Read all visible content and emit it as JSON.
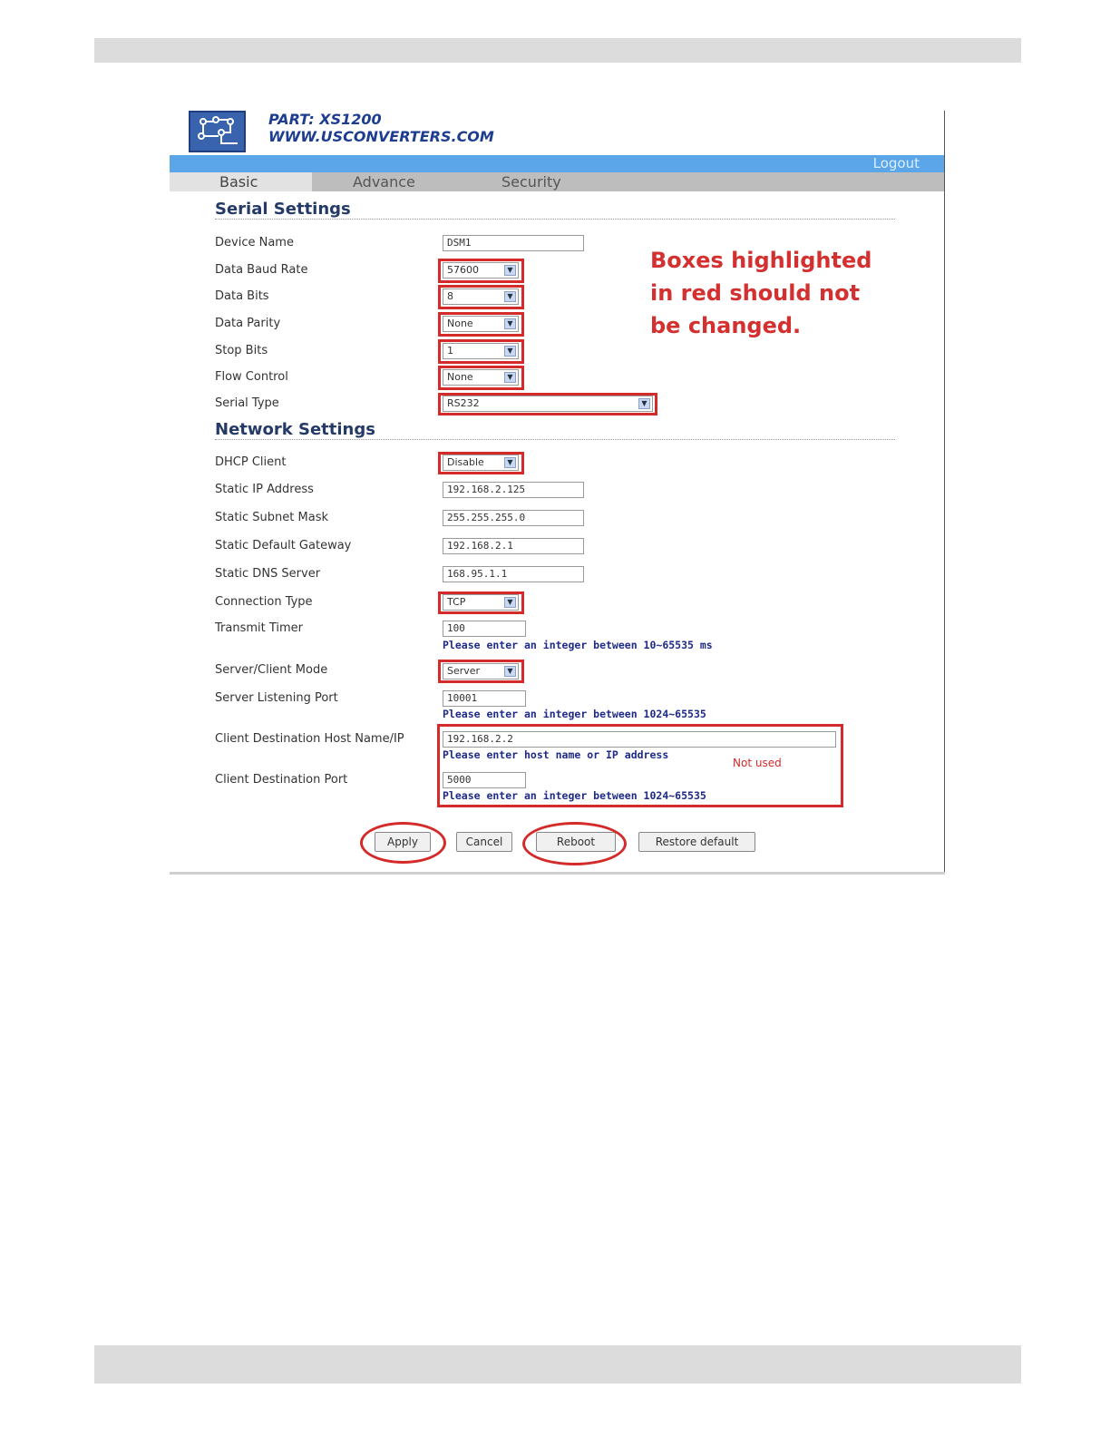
{
  "header": {
    "part_title": "PART: XS1200",
    "part_url": "WWW.USCONVERTERS.COM",
    "logo_icon": "circuit-board-icon",
    "logout": "Logout"
  },
  "tabs": [
    {
      "label": "Basic",
      "active": true
    },
    {
      "label": "Advance",
      "active": false
    },
    {
      "label": "Security",
      "active": false
    }
  ],
  "serial": {
    "title": "Serial Settings",
    "device_name": {
      "label": "Device Name",
      "value": "DSM1"
    },
    "baud_rate": {
      "label": "Data Baud Rate",
      "value": "57600"
    },
    "data_bits": {
      "label": "Data Bits",
      "value": "8"
    },
    "parity": {
      "label": "Data Parity",
      "value": "None"
    },
    "stop_bits": {
      "label": "Stop Bits",
      "value": "1"
    },
    "flow_control": {
      "label": "Flow Control",
      "value": "None"
    },
    "serial_type": {
      "label": "Serial Type",
      "value": "RS232"
    }
  },
  "network": {
    "title": "Network Settings",
    "dhcp": {
      "label": "DHCP Client",
      "value": "Disable"
    },
    "ip": {
      "label": "Static IP Address",
      "value": "192.168.2.125"
    },
    "mask": {
      "label": "Static Subnet Mask",
      "value": "255.255.255.0"
    },
    "gateway": {
      "label": "Static Default Gateway",
      "value": "192.168.2.1"
    },
    "dns": {
      "label": "Static DNS Server",
      "value": "168.95.1.1"
    },
    "conn_type": {
      "label": "Connection Type",
      "value": "TCP"
    },
    "timer": {
      "label": "Transmit Timer",
      "value": "100",
      "hint": "Please enter an integer between 10~65535 ms"
    },
    "mode": {
      "label": "Server/Client Mode",
      "value": "Server"
    },
    "listen_port": {
      "label": "Server Listening Port",
      "value": "10001",
      "hint": "Please enter an integer between 1024~65535"
    },
    "dest_host": {
      "label": "Client Destination Host Name/IP",
      "value": "192.168.2.2",
      "hint": "Please enter host name or IP address"
    },
    "dest_port": {
      "label": "Client Destination Port",
      "value": "5000",
      "hint": "Please enter an integer between 1024~65535"
    }
  },
  "annotations": {
    "note": "Boxes highlighted in red should not be changed.",
    "not_used": "Not used",
    "highlight_color": "#d42a2a"
  },
  "buttons": {
    "apply": "Apply",
    "cancel": "Cancel",
    "reboot": "Reboot",
    "restore": "Restore default"
  }
}
